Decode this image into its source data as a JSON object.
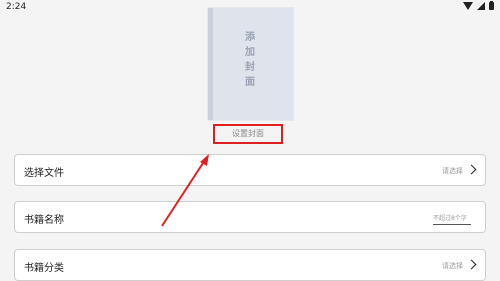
{
  "status_bar": {
    "time": "2:24"
  },
  "cover": {
    "placeholder_chars": [
      "添",
      "加",
      "封",
      "面"
    ]
  },
  "set_cover_label": "设置封面",
  "rows": {
    "file": {
      "label": "选择文件",
      "hint": "请选择"
    },
    "name": {
      "label": "书籍名称",
      "placeholder": "不超过8个字"
    },
    "category": {
      "label": "书籍分类",
      "hint": "请选择"
    }
  },
  "colors": {
    "highlight": "#e02020",
    "background": "#f4f4f4",
    "cover": "#dfe3ec"
  }
}
